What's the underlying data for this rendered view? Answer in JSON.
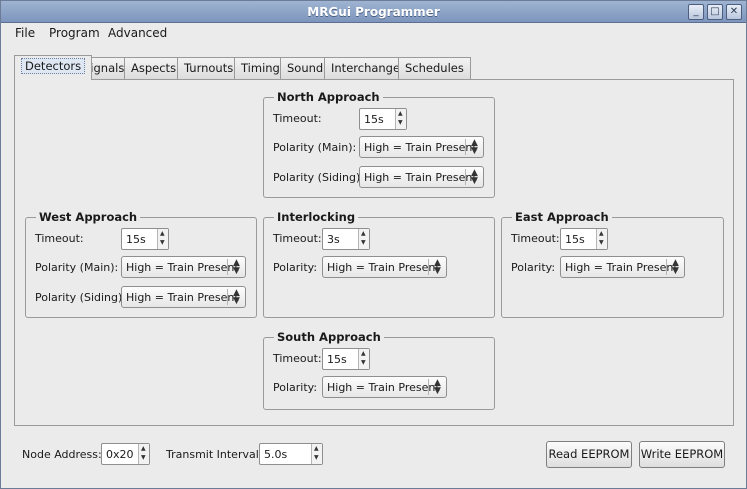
{
  "window": {
    "title": "MRGui Programmer",
    "controls": {
      "minimize": "_",
      "maximize": "□",
      "close": "✕"
    }
  },
  "menu": {
    "items": [
      "File",
      "Program",
      "Advanced"
    ]
  },
  "tabs": [
    "Detectors",
    "Signals",
    "Aspects",
    "Turnouts",
    "Timing",
    "Sound",
    "Interchange",
    "Schedules"
  ],
  "active_tab": "Detectors",
  "detectors": {
    "north": {
      "title": "North Approach",
      "timeout_label": "Timeout:",
      "timeout_value": "15s",
      "polarity_main_label": "Polarity (Main):",
      "polarity_main_value": "High = Train Present",
      "polarity_siding_label": "Polarity (Siding):",
      "polarity_siding_value": "High = Train Present"
    },
    "west": {
      "title": "West Approach",
      "timeout_label": "Timeout:",
      "timeout_value": "15s",
      "polarity_main_label": "Polarity (Main):",
      "polarity_main_value": "High = Train Present",
      "polarity_siding_label": "Polarity (Siding):",
      "polarity_siding_value": "High = Train Present"
    },
    "interlocking": {
      "title": "Interlocking",
      "timeout_label": "Timeout:",
      "timeout_value": "3s",
      "polarity_label": "Polarity:",
      "polarity_value": "High = Train Present"
    },
    "east": {
      "title": "East Approach",
      "timeout_label": "Timeout:",
      "timeout_value": "15s",
      "polarity_label": "Polarity:",
      "polarity_value": "High = Train Present"
    },
    "south": {
      "title": "South Approach",
      "timeout_label": "Timeout:",
      "timeout_value": "15s",
      "polarity_label": "Polarity:",
      "polarity_value": "High = Train Present"
    }
  },
  "footer": {
    "node_address_label": "Node Address:",
    "node_address_value": "0x20",
    "transmit_interval_label": "Transmit Interval:",
    "transmit_interval_value": "5.0s",
    "read_button": "Read EEPROM",
    "write_button": "Write EEPROM"
  },
  "icons": {
    "spin_up": "▲",
    "spin_down": "▼",
    "combo_up": "▲",
    "combo_down": "▼"
  }
}
